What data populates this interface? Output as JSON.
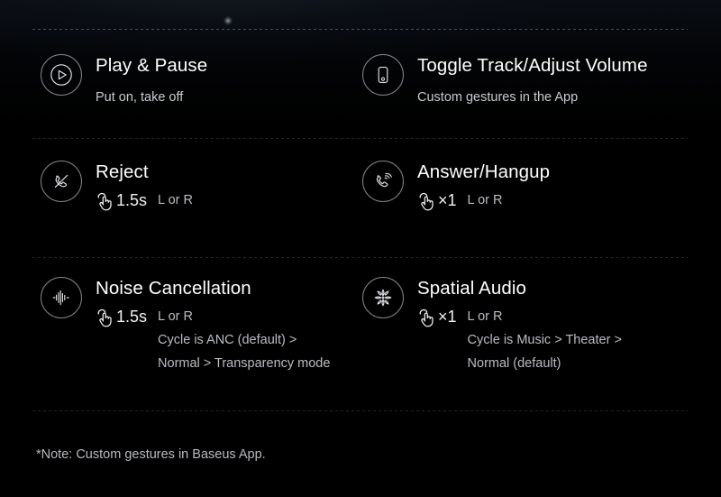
{
  "page": {
    "background_color": "#000000",
    "accent_color": "#ffffff",
    "muted_text_color": "#b9bcc2"
  },
  "features": [
    {
      "icon": "play-circle-icon",
      "title": "Play & Pause",
      "subtitle": "Put on, take off",
      "gesture_icon": "",
      "duration": "",
      "side": "",
      "cycle_line1": "",
      "cycle_line2": ""
    },
    {
      "icon": "earbud-device-icon",
      "title": "Toggle Track/Adjust Volume",
      "subtitle": "Custom gestures in the App",
      "gesture_icon": "",
      "duration": "",
      "side": "",
      "cycle_line1": "",
      "cycle_line2": ""
    },
    {
      "icon": "phone-reject-icon",
      "title": "Reject",
      "subtitle": "",
      "gesture_icon": "tap-hand-icon",
      "duration": "1.5s",
      "side": "L or R",
      "cycle_line1": "",
      "cycle_line2": ""
    },
    {
      "icon": "phone-ringing-icon",
      "title": "Answer/Hangup",
      "subtitle": "",
      "gesture_icon": "tap-hand-icon",
      "duration": "×1",
      "side": "L or R",
      "cycle_line1": "",
      "cycle_line2": ""
    },
    {
      "icon": "noise-cancellation-waveform-icon",
      "title": "Noise Cancellation",
      "subtitle": "",
      "gesture_icon": "tap-hand-icon",
      "duration": "1.5s",
      "side": "L or R",
      "cycle_line1": "Cycle is ANC (default) >",
      "cycle_line2": "Normal > Transparency mode"
    },
    {
      "icon": "spatial-audio-icon",
      "title": "Spatial Audio",
      "subtitle": "",
      "gesture_icon": "tap-hand-icon",
      "duration": "×1",
      "side": "L or R",
      "cycle_line1": "Cycle is Music > Theater >",
      "cycle_line2": "Normal (default)"
    }
  ],
  "footer": {
    "note": "*Note: Custom gestures in Baseus App."
  }
}
